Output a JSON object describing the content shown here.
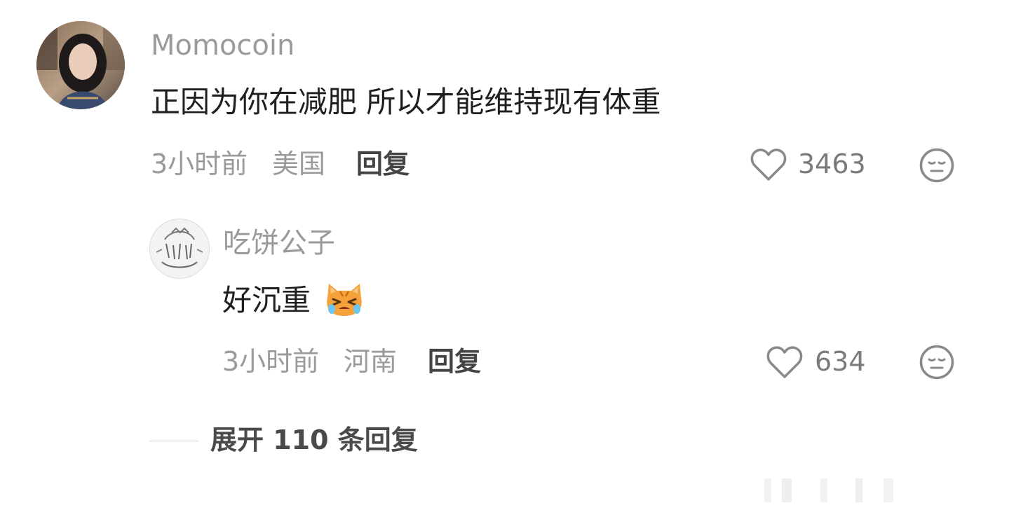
{
  "comment": {
    "username": "Momocoin",
    "text": "正因为你在减肥 所以才能维持现有体重",
    "time": "3小时前",
    "location": "美国",
    "reply_label": "回复",
    "likes": "3463",
    "like_icon": "heart-outline-icon",
    "dislike_icon": "neutral-face-icon"
  },
  "reply": {
    "username": "吃饼公子",
    "text": "好沉重",
    "emoji": "crying-cat-emoji",
    "time": "3小时前",
    "location": "河南",
    "reply_label": "回复",
    "likes": "634",
    "like_icon": "heart-outline-icon",
    "dislike_icon": "neutral-face-icon"
  },
  "expand_replies": {
    "label": "展开 110 条回复"
  },
  "colors": {
    "username": "#9a9a9a",
    "text": "#1f1f1f",
    "meta": "#9a9a9a",
    "action": "#444444",
    "icon": "#8a8a8a"
  }
}
